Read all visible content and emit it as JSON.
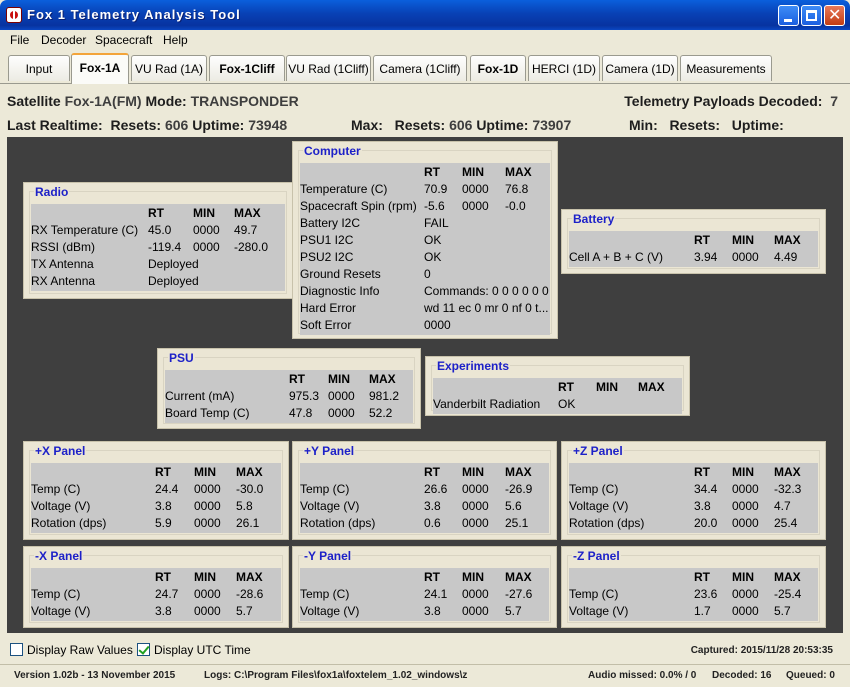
{
  "window": {
    "title": "Fox 1 Telemetry Analysis Tool"
  },
  "menu": [
    "File",
    "Decoder",
    "Spacecraft",
    "Help"
  ],
  "tabs": [
    {
      "label": "Input",
      "bold": false
    },
    {
      "label": "Fox-1A",
      "bold": true,
      "active": true
    },
    {
      "label": "VU Rad (1A)",
      "bold": false
    },
    {
      "label": "Fox-1Cliff",
      "bold": true
    },
    {
      "label": "VU Rad (1Cliff)",
      "bold": false
    },
    {
      "label": "Camera (1Cliff)",
      "bold": false
    },
    {
      "label": "Fox-1D",
      "bold": true
    },
    {
      "label": "HERCI (1D)",
      "bold": false
    },
    {
      "label": "Camera (1D)",
      "bold": false
    },
    {
      "label": "Measurements",
      "bold": false
    }
  ],
  "header": {
    "satellite_label": "Satellite",
    "satellite_value": "Fox-1A(FM)",
    "mode_label": "Mode:",
    "mode_value": "TRANSPONDER",
    "payloads_label": "Telemetry Payloads Decoded:",
    "payloads_value": "7",
    "last_realtime_label": "Last Realtime:",
    "resets_label": "Resets:",
    "resets_value": "606",
    "uptime_label": "Uptime:",
    "uptime_value": "73948",
    "max_label": "Max:",
    "max_resets_label": "Resets:",
    "max_resets_value": "606",
    "max_uptime_label": "Uptime:",
    "max_uptime_value": "73907",
    "min_label": "Min:",
    "min_resets_label": "Resets:",
    "min_uptime_label": "Uptime:"
  },
  "col_headers": {
    "rt": "RT",
    "min": "MIN",
    "max": "MAX"
  },
  "panels": {
    "radio": {
      "title": "Radio",
      "rows": [
        {
          "label": "RX Temperature (C)",
          "rt": "45.0",
          "min": "0000",
          "max": "49.7"
        },
        {
          "label": "RSSI (dBm)",
          "rt": "-119.4",
          "min": "0000",
          "max": "-280.0"
        },
        {
          "label": "TX Antenna",
          "rt": "Deployed",
          "min": "",
          "max": ""
        },
        {
          "label": "RX Antenna",
          "rt": "Deployed",
          "min": "",
          "max": ""
        }
      ]
    },
    "computer": {
      "title": "Computer",
      "rows": [
        {
          "label": "Temperature (C)",
          "rt": "70.9",
          "min": "0000",
          "max": "76.8"
        },
        {
          "label": "Spacecraft Spin (rpm)",
          "rt": "-5.6",
          "min": "0000",
          "max": "-0.0"
        },
        {
          "label": "Battery I2C",
          "rt": "FAIL",
          "min": "",
          "max": ""
        },
        {
          "label": "PSU1 I2C",
          "rt": "OK",
          "min": "",
          "max": ""
        },
        {
          "label": "PSU2 I2C",
          "rt": "OK",
          "min": "",
          "max": ""
        },
        {
          "label": "Ground Resets",
          "rt": "0",
          "min": "",
          "max": ""
        },
        {
          "label": "Diagnostic Info",
          "rt": "Commands: 0 0 0 0 0 0",
          "min": "",
          "max": ""
        },
        {
          "label": "Hard Error",
          "rt": "wd 11 ec 0 mr 0 nf 0 t...",
          "min": "",
          "max": ""
        },
        {
          "label": "Soft Error",
          "rt": "0000",
          "min": "",
          "max": ""
        }
      ]
    },
    "battery": {
      "title": "Battery",
      "rows": [
        {
          "label": "Cell A + B + C (V)",
          "rt": "3.94",
          "min": "0000",
          "max": "4.49"
        }
      ]
    },
    "psu": {
      "title": "PSU",
      "rows": [
        {
          "label": "Current (mA)",
          "rt": "975.3",
          "min": "0000",
          "max": "981.2"
        },
        {
          "label": "Board Temp (C)",
          "rt": "47.8",
          "min": "0000",
          "max": "52.2"
        }
      ]
    },
    "experiments": {
      "title": "Experiments",
      "rows": [
        {
          "label": "Vanderbilt Radiation",
          "rt": "OK",
          "min": "",
          "max": ""
        }
      ]
    },
    "xpos": {
      "title": "+X Panel",
      "rows": [
        {
          "label": "Temp (C)",
          "rt": "24.4",
          "min": "0000",
          "max": "-30.0"
        },
        {
          "label": "Voltage (V)",
          "rt": "3.8",
          "min": "0000",
          "max": "5.8"
        },
        {
          "label": "Rotation (dps)",
          "rt": "5.9",
          "min": "0000",
          "max": "26.1"
        }
      ]
    },
    "ypos": {
      "title": "+Y Panel",
      "rows": [
        {
          "label": "Temp (C)",
          "rt": "26.6",
          "min": "0000",
          "max": "-26.9"
        },
        {
          "label": "Voltage (V)",
          "rt": "3.8",
          "min": "0000",
          "max": "5.6"
        },
        {
          "label": "Rotation (dps)",
          "rt": "0.6",
          "min": "0000",
          "max": "25.1"
        }
      ]
    },
    "zpos": {
      "title": "+Z Panel",
      "rows": [
        {
          "label": "Temp (C)",
          "rt": "34.4",
          "min": "0000",
          "max": "-32.3"
        },
        {
          "label": "Voltage (V)",
          "rt": "3.8",
          "min": "0000",
          "max": "4.7"
        },
        {
          "label": "Rotation (dps)",
          "rt": "20.0",
          "min": "0000",
          "max": "25.4"
        }
      ]
    },
    "xneg": {
      "title": "-X Panel",
      "rows": [
        {
          "label": "Temp (C)",
          "rt": "24.7",
          "min": "0000",
          "max": "-28.6"
        },
        {
          "label": "Voltage (V)",
          "rt": "3.8",
          "min": "0000",
          "max": "5.7"
        }
      ]
    },
    "yneg": {
      "title": "-Y Panel",
      "rows": [
        {
          "label": "Temp (C)",
          "rt": "24.1",
          "min": "0000",
          "max": "-27.6"
        },
        {
          "label": "Voltage (V)",
          "rt": "3.8",
          "min": "0000",
          "max": "5.7"
        }
      ]
    },
    "zneg": {
      "title": "-Z Panel",
      "rows": [
        {
          "label": "Temp (C)",
          "rt": "23.6",
          "min": "0000",
          "max": "-25.4"
        },
        {
          "label": "Voltage (V)",
          "rt": "1.7",
          "min": "0000",
          "max": "5.7"
        }
      ]
    }
  },
  "options": {
    "display_raw_label": "Display Raw Values",
    "display_raw_checked": false,
    "display_utc_label": "Display UTC Time",
    "display_utc_checked": true,
    "captured_text": "Captured: 2015/11/28 20:53:35"
  },
  "status": {
    "version": "Version 1.02b - 13 November 2015",
    "logs": "Logs: C:\\Program Files\\fox1a\\foxtelem_1.02_windows\\z",
    "audio_missed": "Audio missed: 0.0% / 0",
    "decoded": "Decoded: 16",
    "queued": "Queued: 0"
  }
}
